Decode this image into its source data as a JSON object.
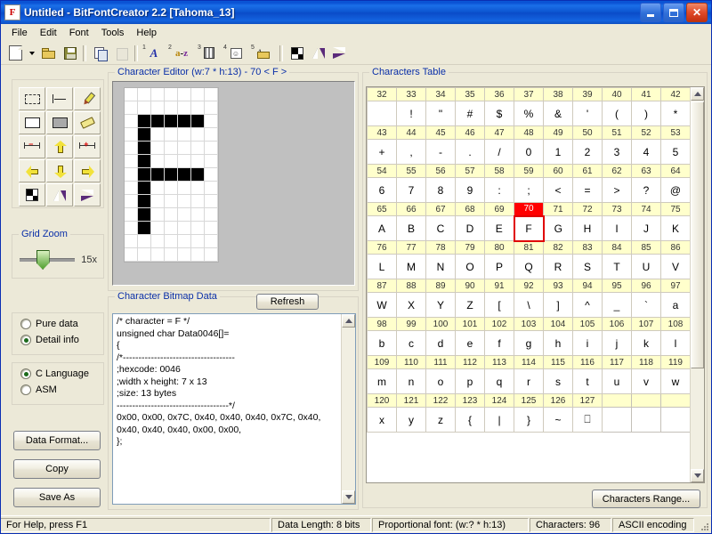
{
  "window": {
    "title": "Untitled - BitFontCreator 2.2 [Tahoma_13]",
    "icon_letter": "F",
    "buttons": {
      "minimize": "minimize-button",
      "maximize": "maximize-button",
      "close": "close-button"
    }
  },
  "menu": {
    "items": [
      {
        "label": "File"
      },
      {
        "label": "Edit"
      },
      {
        "label": "Font"
      },
      {
        "label": "Tools"
      },
      {
        "label": "Help"
      }
    ]
  },
  "toolbar": {
    "buttons": [
      {
        "name": "new-file-icon",
        "badge": ""
      },
      {
        "name": "new-file-dropdown-icon",
        "badge": ""
      },
      {
        "name": "open-file-icon",
        "badge": ""
      },
      {
        "name": "save-file-icon",
        "badge": ""
      },
      {
        "name": "copy-icon",
        "badge": ""
      },
      {
        "name": "paste-icon",
        "badge": ""
      },
      {
        "name": "font-select-icon",
        "badge": "1"
      },
      {
        "name": "character-range-icon",
        "badge": "2"
      },
      {
        "name": "columns-icon",
        "badge": "3"
      },
      {
        "name": "preview-icon",
        "badge": "4"
      },
      {
        "name": "export-icon",
        "badge": "5"
      },
      {
        "name": "invert-icon",
        "badge": ""
      },
      {
        "name": "flip-vertical-icon",
        "badge": ""
      },
      {
        "name": "flip-horizontal-icon",
        "badge": ""
      }
    ]
  },
  "tool_palette": {
    "tools": [
      {
        "name": "select-rect-tool"
      },
      {
        "name": "line-tool"
      },
      {
        "name": "pencil-tool"
      },
      {
        "name": "rectangle-tool"
      },
      {
        "name": "filled-rectangle-tool"
      },
      {
        "name": "eraser-tool"
      },
      {
        "name": "decrease-width-tool"
      },
      {
        "name": "shift-up-tool"
      },
      {
        "name": "increase-width-tool"
      },
      {
        "name": "shift-left-tool"
      },
      {
        "name": "shift-down-tool"
      },
      {
        "name": "shift-right-tool"
      },
      {
        "name": "invert-tool"
      },
      {
        "name": "flip-vertical-tool"
      },
      {
        "name": "flip-horizontal-tool"
      }
    ]
  },
  "grid_zoom": {
    "label": "Grid Zoom",
    "value": "15x",
    "slider_percent": 38
  },
  "char_editor": {
    "title": "Character Editor (w:7 * h:13) - 70 < F >",
    "width": 7,
    "height": 13,
    "code": 70,
    "character": "F",
    "bitmap_rows": [
      [
        0,
        0,
        0,
        0,
        0,
        0,
        0
      ],
      [
        0,
        0,
        0,
        0,
        0,
        0,
        0
      ],
      [
        0,
        1,
        1,
        1,
        1,
        1,
        0
      ],
      [
        0,
        1,
        0,
        0,
        0,
        0,
        0
      ],
      [
        0,
        1,
        0,
        0,
        0,
        0,
        0
      ],
      [
        0,
        1,
        0,
        0,
        0,
        0,
        0
      ],
      [
        0,
        1,
        1,
        1,
        1,
        1,
        0
      ],
      [
        0,
        1,
        0,
        0,
        0,
        0,
        0
      ],
      [
        0,
        1,
        0,
        0,
        0,
        0,
        0
      ],
      [
        0,
        1,
        0,
        0,
        0,
        0,
        0
      ],
      [
        0,
        1,
        0,
        0,
        0,
        0,
        0
      ],
      [
        0,
        0,
        0,
        0,
        0,
        0,
        0
      ],
      [
        0,
        0,
        0,
        0,
        0,
        0,
        0
      ]
    ]
  },
  "bitmap_data": {
    "title": "Character Bitmap Data",
    "refresh_label": "Refresh",
    "text": "/* character = F */\nunsigned char Data0046[]=\n{\n/*------------------------------------\n;hexcode: 0046\n;width x height: 7 x 13\n;size: 13 bytes\n------------------------------------*/\n0x00, 0x00, 0x7C, 0x40, 0x40, 0x40, 0x7C, 0x40,\n0x40, 0x40, 0x40, 0x00, 0x00,\n};"
  },
  "data_options": {
    "mode_group": [
      {
        "label": "Pure data",
        "selected": false
      },
      {
        "label": "Detail info",
        "selected": true
      }
    ],
    "language_group": [
      {
        "label": "C Language",
        "selected": true
      },
      {
        "label": "ASM",
        "selected": false
      }
    ],
    "buttons": [
      {
        "label": "Data Format...",
        "name": "data-format-button"
      },
      {
        "label": "Copy",
        "name": "copy-button"
      },
      {
        "label": "Save As",
        "name": "save-as-button"
      }
    ]
  },
  "chars_table": {
    "title": "Characters Table",
    "range_button": "Characters Range...",
    "selected_code": 70,
    "rows": [
      {
        "codes": [
          32,
          33,
          34,
          35,
          36,
          37,
          38,
          39,
          40,
          41,
          42
        ],
        "glyphs": [
          "",
          "!",
          "\"",
          "#",
          "$",
          "%",
          "&",
          "'",
          "(",
          ")",
          "*"
        ]
      },
      {
        "codes": [
          43,
          44,
          45,
          46,
          47,
          48,
          49,
          50,
          51,
          52,
          53
        ],
        "glyphs": [
          "+",
          ",",
          "-",
          ".",
          "/",
          "0",
          "1",
          "2",
          "3",
          "4",
          "5"
        ]
      },
      {
        "codes": [
          54,
          55,
          56,
          57,
          58,
          59,
          60,
          61,
          62,
          63,
          64
        ],
        "glyphs": [
          "6",
          "7",
          "8",
          "9",
          ":",
          ";",
          "<",
          "=",
          ">",
          "?",
          "@"
        ]
      },
      {
        "codes": [
          65,
          66,
          67,
          68,
          69,
          70,
          71,
          72,
          73,
          74,
          75
        ],
        "glyphs": [
          "A",
          "B",
          "C",
          "D",
          "E",
          "F",
          "G",
          "H",
          "I",
          "J",
          "K"
        ]
      },
      {
        "codes": [
          76,
          77,
          78,
          79,
          80,
          81,
          82,
          83,
          84,
          85,
          86
        ],
        "glyphs": [
          "L",
          "M",
          "N",
          "O",
          "P",
          "Q",
          "R",
          "S",
          "T",
          "U",
          "V"
        ]
      },
      {
        "codes": [
          87,
          88,
          89,
          90,
          91,
          92,
          93,
          94,
          95,
          96,
          97
        ],
        "glyphs": [
          "W",
          "X",
          "Y",
          "Z",
          "[",
          "\\",
          "]",
          "^",
          "_",
          "`",
          "a"
        ]
      },
      {
        "codes": [
          98,
          99,
          100,
          101,
          102,
          103,
          104,
          105,
          106,
          107,
          108
        ],
        "glyphs": [
          "b",
          "c",
          "d",
          "e",
          "f",
          "g",
          "h",
          "i",
          "j",
          "k",
          "l"
        ]
      },
      {
        "codes": [
          109,
          110,
          111,
          112,
          113,
          114,
          115,
          116,
          117,
          118,
          119
        ],
        "glyphs": [
          "m",
          "n",
          "o",
          "p",
          "q",
          "r",
          "s",
          "t",
          "u",
          "v",
          "w"
        ]
      },
      {
        "codes": [
          120,
          121,
          122,
          123,
          124,
          125,
          126,
          127,
          null,
          null,
          null
        ],
        "glyphs": [
          "x",
          "y",
          "z",
          "{",
          "|",
          "}",
          "~",
          "⎕",
          null,
          null,
          null
        ]
      }
    ]
  },
  "status_bar": {
    "help": "For Help, press F1",
    "data_length": "Data Length: 8 bits",
    "font_info": "Proportional font: (w:? * h:13)",
    "characters": "Characters: 96",
    "encoding": "ASCII encoding"
  },
  "colors": {
    "title_bar_blue": "#0a51d4",
    "panel_bg": "#ece9d8",
    "code_cell_yellow": "#ffffcc",
    "selection_red": "#ff0000",
    "label_blue": "#0a2fa8"
  }
}
